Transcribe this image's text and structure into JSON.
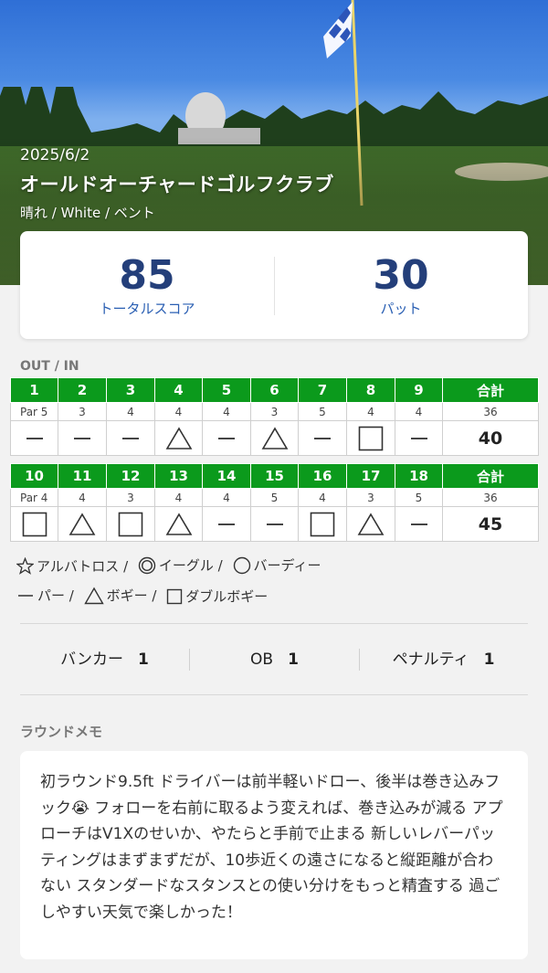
{
  "round": {
    "date": "2025/6/2",
    "course_name": "オールドオーチャードゴルフクラブ",
    "conditions": "晴れ / White  / ベント"
  },
  "summary": {
    "total_score": "85",
    "total_score_label": "トータルスコア",
    "putts": "30",
    "putts_label": "パット"
  },
  "scorecard": {
    "section_label": "OUT / IN",
    "total_header": "合計",
    "out": {
      "holes": [
        "1",
        "2",
        "3",
        "4",
        "5",
        "6",
        "7",
        "8",
        "9"
      ],
      "par_label": "Par 5",
      "pars": [
        "3",
        "4",
        "4",
        "4",
        "3",
        "5",
        "4",
        "4"
      ],
      "par_total": "36",
      "results": [
        "par",
        "par",
        "par",
        "bogey",
        "par",
        "bogey",
        "par",
        "double-bogey",
        "par"
      ],
      "score_total": "40"
    },
    "in": {
      "holes": [
        "10",
        "11",
        "12",
        "13",
        "14",
        "15",
        "16",
        "17",
        "18"
      ],
      "par_label": "Par 4",
      "pars": [
        "4",
        "3",
        "4",
        "4",
        "5",
        "4",
        "3",
        "5"
      ],
      "par_total": "36",
      "results": [
        "double-bogey",
        "bogey",
        "double-bogey",
        "bogey",
        "par",
        "par",
        "double-bogey",
        "bogey",
        "par"
      ],
      "score_total": "45"
    }
  },
  "legend": {
    "albatross": "アルバトロス /",
    "eagle": "イーグル /",
    "birdie": "バーディー",
    "par": "パー /",
    "bogey": "ボギー /",
    "double_bogey": "ダブルボギー"
  },
  "stats": {
    "bunker_label": "バンカー",
    "bunker_value": "1",
    "ob_label": "OB",
    "ob_value": "1",
    "penalty_label": "ペナルティ",
    "penalty_value": "1"
  },
  "memo": {
    "label": "ラウンドメモ",
    "text": "初ラウンド9.5ft ドライバーは前半軽いドロー、後半は巻き込みフック😭 フォローを右前に取るよう変えれば、巻き込みが減る アプローチはV1Xのせいか、やたらと手前で止まる 新しいレバーパッティングはまずまずだが、10歩近くの遠さになると縦距離が合わない スタンダードなスタンスとの使い分けをもっと精査する 過ごしやすい天気で楽しかった！"
  },
  "colors": {
    "header_green": "#0b9a1c",
    "score_navy": "#243f7a",
    "label_blue": "#2a5fb3"
  }
}
